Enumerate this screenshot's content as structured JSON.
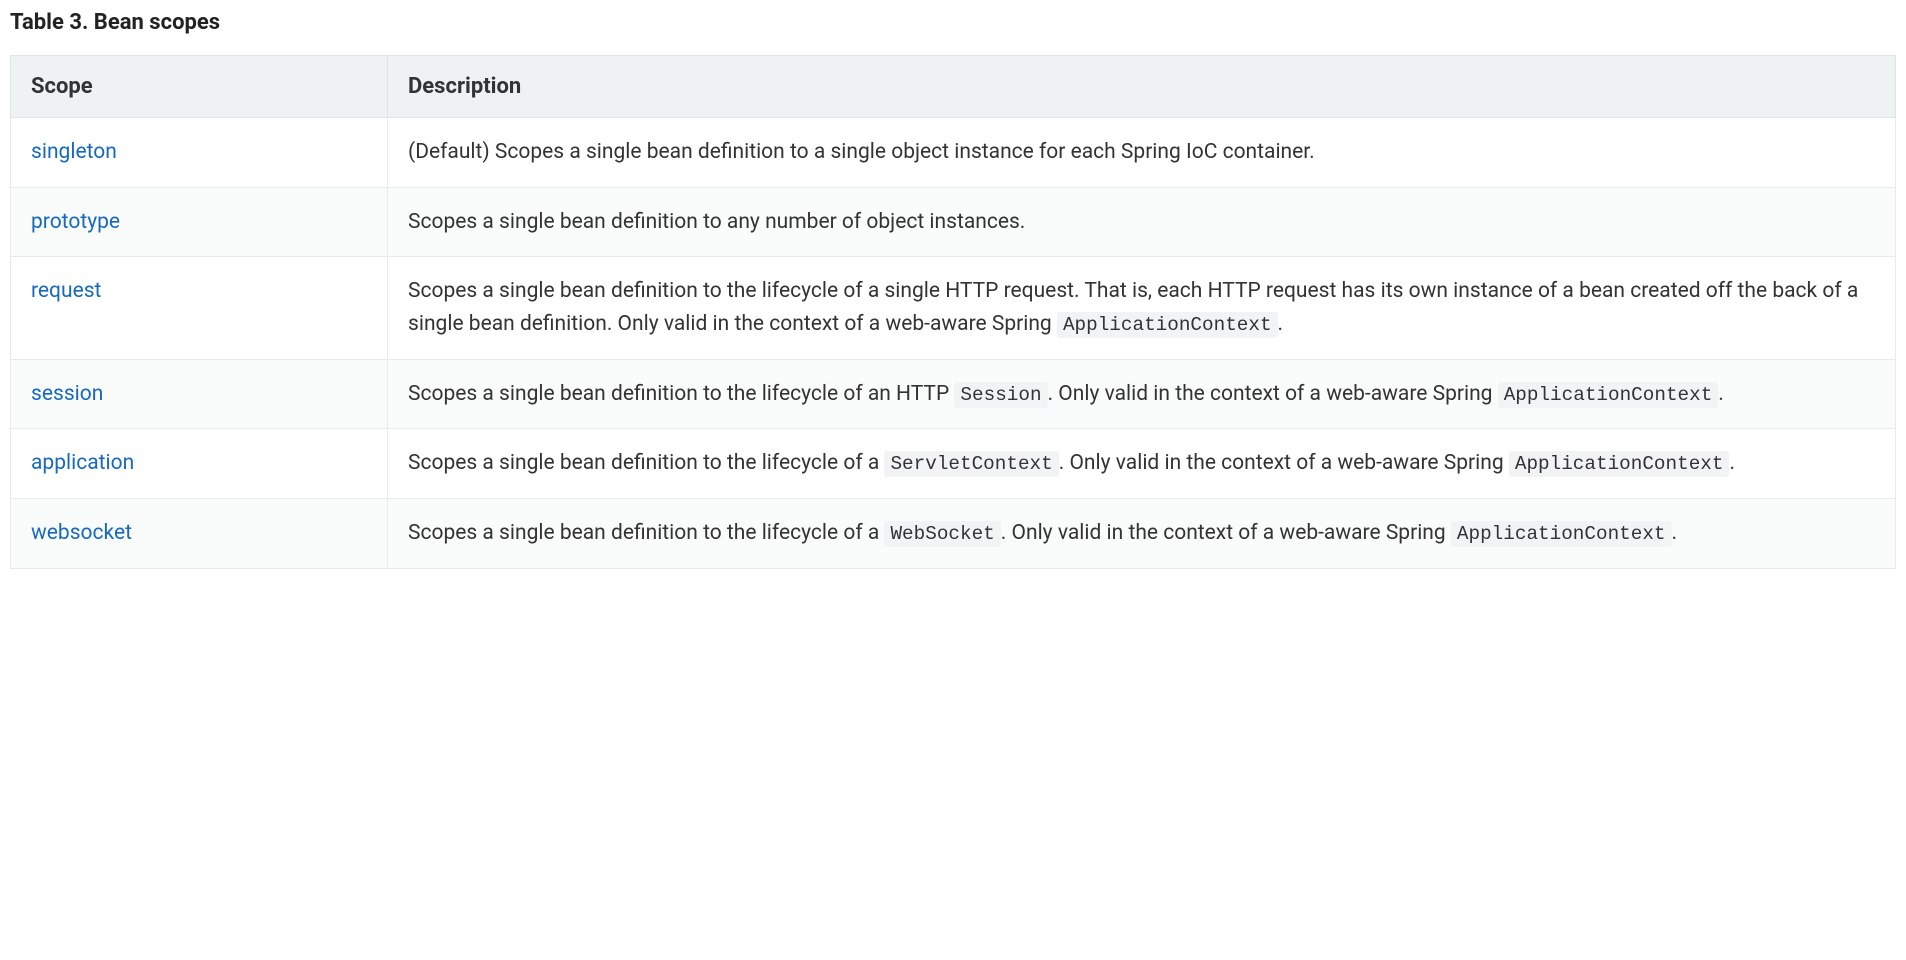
{
  "caption": "Table 3. Bean scopes",
  "headers": {
    "scope": "Scope",
    "description": "Description"
  },
  "rows": [
    {
      "scope": "singleton",
      "desc_pre": "(Default) Scopes a single bean definition to a single object instance for each Spring IoC container.",
      "code1": "",
      "desc_mid": "",
      "code2": "",
      "desc_post": ""
    },
    {
      "scope": "prototype",
      "desc_pre": "Scopes a single bean definition to any number of object instances.",
      "code1": "",
      "desc_mid": "",
      "code2": "",
      "desc_post": ""
    },
    {
      "scope": "request",
      "desc_pre": "Scopes a single bean definition to the lifecycle of a single HTTP request. That is, each HTTP request has its own instance of a bean created off the back of a single bean definition. Only valid in the context of a web-aware Spring ",
      "code1": "ApplicationContext",
      "desc_mid": ".",
      "code2": "",
      "desc_post": ""
    },
    {
      "scope": "session",
      "desc_pre": "Scopes a single bean definition to the lifecycle of an HTTP ",
      "code1": "Session",
      "desc_mid": ". Only valid in the context of a web-aware Spring ",
      "code2": "ApplicationContext",
      "desc_post": "."
    },
    {
      "scope": "application",
      "desc_pre": "Scopes a single bean definition to the lifecycle of a ",
      "code1": "ServletContext",
      "desc_mid": ". Only valid in the context of a web-aware Spring ",
      "code2": "ApplicationContext",
      "desc_post": "."
    },
    {
      "scope": "websocket",
      "desc_pre": "Scopes a single bean definition to the lifecycle of a ",
      "code1": "WebSocket",
      "desc_mid": ". Only valid in the context of a web-aware Spring ",
      "code2": "ApplicationContext",
      "desc_post": "."
    }
  ]
}
